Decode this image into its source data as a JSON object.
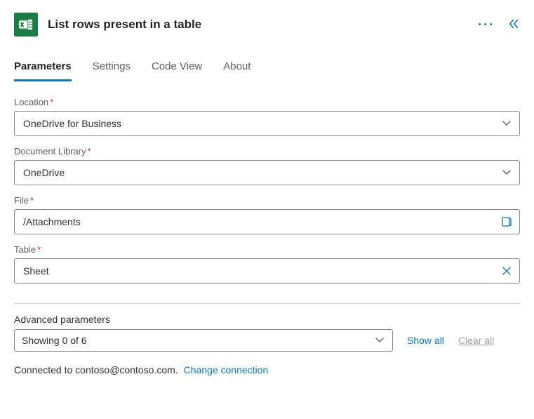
{
  "header": {
    "title": "List rows present in a table"
  },
  "tabs": {
    "parameters": "Parameters",
    "settings": "Settings",
    "codeview": "Code View",
    "about": "About"
  },
  "fields": {
    "location": {
      "label": "Location",
      "value": "OneDrive for Business"
    },
    "library": {
      "label": "Document Library",
      "value": "OneDrive"
    },
    "file": {
      "label": "File",
      "value": "/Attachments"
    },
    "table": {
      "label": "Table",
      "value": "Sheet"
    }
  },
  "advanced": {
    "label": "Advanced parameters",
    "summary": "Showing 0 of 6",
    "showall": "Show all",
    "clearall": "Clear all"
  },
  "footer": {
    "connected_prefix": "Connected to ",
    "account": "contoso@contoso.com.",
    "change": "Change connection"
  }
}
